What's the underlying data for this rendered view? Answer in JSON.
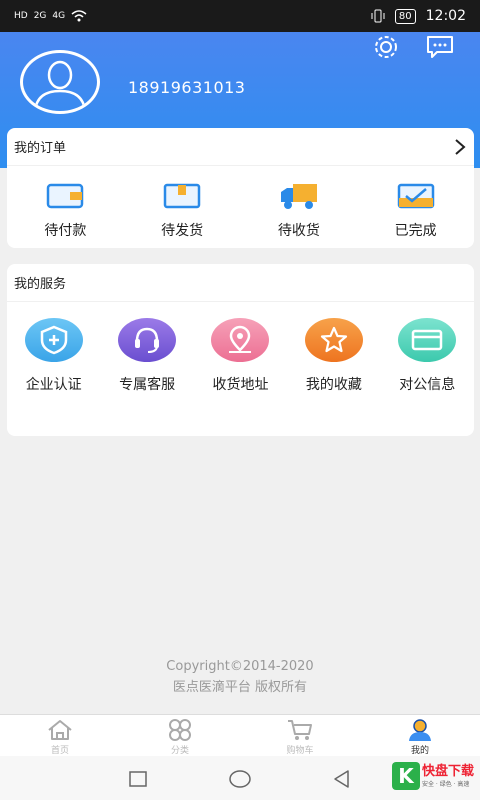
{
  "status": {
    "time": "12:02",
    "battery": "80",
    "net1": "HD",
    "net2": "2G",
    "net3": "4G"
  },
  "header": {
    "phone": "18919631013"
  },
  "orders": {
    "title": "我的订单",
    "items": [
      {
        "label": "待付款"
      },
      {
        "label": "待发货"
      },
      {
        "label": "待收货"
      },
      {
        "label": "已完成"
      }
    ]
  },
  "services": {
    "title": "我的服务",
    "items": [
      {
        "label": "企业认证"
      },
      {
        "label": "专属客服"
      },
      {
        "label": "收货地址"
      },
      {
        "label": "我的收藏"
      },
      {
        "label": "对公信息"
      }
    ]
  },
  "footer": {
    "line1": "Copyright©2014-2020",
    "line2": "医点医滴平台 版权所有"
  },
  "tabs": [
    {
      "label": "首页"
    },
    {
      "label": "分类"
    },
    {
      "label": "购物车"
    },
    {
      "label": "我的"
    }
  ],
  "watermark": {
    "brand": "快盘下载",
    "letter": "K",
    "sub": "安全 · 绿色 · 高速"
  },
  "colors": {
    "accent": "#3b8ef0",
    "header_top": "#4a86f0"
  }
}
